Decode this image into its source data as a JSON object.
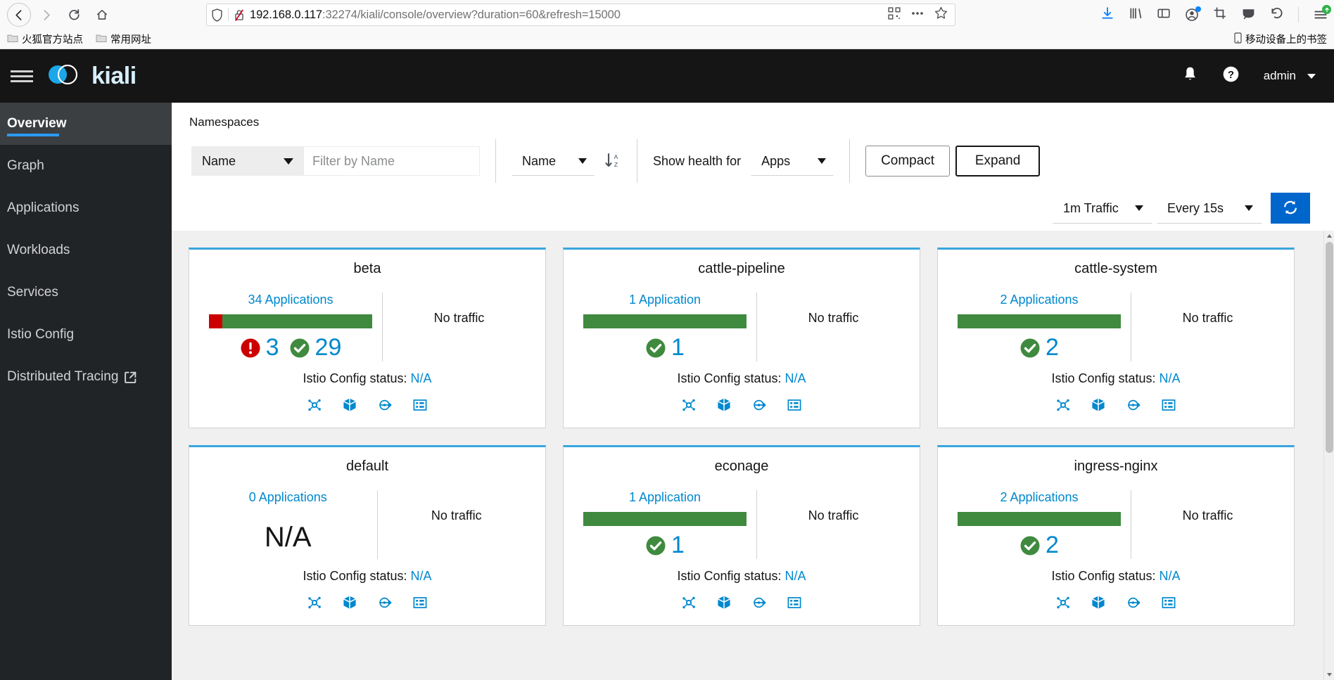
{
  "browser": {
    "url_host": "192.168.0.117",
    "url_rest": ":32274/kiali/console/overview?duration=60&refresh=15000",
    "bookmarks": [
      {
        "label": "火狐官方站点",
        "icon": "folder-icon"
      },
      {
        "label": "常用网址",
        "icon": "folder-icon"
      }
    ],
    "bookmarks_right_label": "移动设备上的书签",
    "toolbar_icons": [
      "download-icon",
      "library-icon",
      "sidebar-icon",
      "account-icon",
      "screenshot-icon",
      "pocket-icon",
      "undo-icon",
      "menu-icon"
    ],
    "nav_icons": [
      "back-icon",
      "forward-icon",
      "reload-icon",
      "home-icon"
    ]
  },
  "masthead": {
    "brand": "kiali",
    "username": "admin",
    "icons": [
      "bell-icon",
      "help-icon",
      "caret-down-icon"
    ]
  },
  "sidebar": {
    "items": [
      {
        "label": "Overview",
        "active": true,
        "external": false
      },
      {
        "label": "Graph",
        "active": false,
        "external": false
      },
      {
        "label": "Applications",
        "active": false,
        "external": false
      },
      {
        "label": "Workloads",
        "active": false,
        "external": false
      },
      {
        "label": "Services",
        "active": false,
        "external": false
      },
      {
        "label": "Istio Config",
        "active": false,
        "external": false
      },
      {
        "label": "Distributed Tracing",
        "active": false,
        "external": true
      }
    ]
  },
  "toolbar": {
    "section_title": "Namespaces",
    "filter_type": "Name",
    "filter_placeholder": "Filter by Name",
    "filter_value": "",
    "sort_by": "Name",
    "sort_direction_icon": "sort-alpha-down-icon",
    "show_health_label": "Show health for",
    "health_for": "Apps",
    "compact_label": "Compact",
    "expand_label": "Expand",
    "traffic_duration": "1m Traffic",
    "refresh_interval": "Every 15s",
    "refresh_icon": "refresh-icon"
  },
  "namespaces": [
    {
      "name": "beta",
      "apps_label": "34 Applications",
      "traffic": "No traffic",
      "istio_config_label": "Istio Config status:",
      "istio_config_value": "N/A",
      "has_bar": true,
      "error_count": "3",
      "healthy_count": "29",
      "error_pct": 8,
      "healthy_pct": 92,
      "na": false,
      "icons": [
        "graph-icon",
        "applications-icon",
        "workloads-icon",
        "istio-config-icon"
      ]
    },
    {
      "name": "cattle-pipeline",
      "apps_label": "1 Application",
      "traffic": "No traffic",
      "istio_config_label": "Istio Config status:",
      "istio_config_value": "N/A",
      "has_bar": true,
      "error_count": null,
      "healthy_count": "1",
      "error_pct": 0,
      "healthy_pct": 100,
      "na": false,
      "icons": [
        "graph-icon",
        "applications-icon",
        "workloads-icon",
        "istio-config-icon"
      ]
    },
    {
      "name": "cattle-system",
      "apps_label": "2 Applications",
      "traffic": "No traffic",
      "istio_config_label": "Istio Config status:",
      "istio_config_value": "N/A",
      "has_bar": true,
      "error_count": null,
      "healthy_count": "2",
      "error_pct": 0,
      "healthy_pct": 100,
      "na": false,
      "icons": [
        "graph-icon",
        "applications-icon",
        "workloads-icon",
        "istio-config-icon"
      ]
    },
    {
      "name": "default",
      "apps_label": "0 Applications",
      "traffic": "No traffic",
      "istio_config_label": "Istio Config status:",
      "istio_config_value": "N/A",
      "has_bar": false,
      "error_count": null,
      "healthy_count": null,
      "error_pct": 0,
      "healthy_pct": 0,
      "na": true,
      "na_text": "N/A",
      "icons": [
        "graph-icon",
        "applications-icon",
        "workloads-icon",
        "istio-config-icon"
      ]
    },
    {
      "name": "econage",
      "apps_label": "1 Application",
      "traffic": "No traffic",
      "istio_config_label": "Istio Config status:",
      "istio_config_value": "N/A",
      "has_bar": true,
      "error_count": null,
      "healthy_count": "1",
      "error_pct": 0,
      "healthy_pct": 100,
      "na": false,
      "icons": [
        "graph-icon",
        "applications-icon",
        "workloads-icon",
        "istio-config-icon"
      ]
    },
    {
      "name": "ingress-nginx",
      "apps_label": "2 Applications",
      "traffic": "No traffic",
      "istio_config_label": "Istio Config status:",
      "istio_config_value": "N/A",
      "has_bar": true,
      "error_count": null,
      "healthy_count": "2",
      "error_pct": 0,
      "healthy_pct": 100,
      "na": false,
      "icons": [
        "graph-icon",
        "applications-icon",
        "workloads-icon",
        "istio-config-icon"
      ]
    }
  ],
  "colors": {
    "accent_blue": "#0088ce",
    "card_top_border": "#39a5dc",
    "healthy_green": "#3f8a3f",
    "error_red": "#cc0000",
    "primary_button": "#0066cc",
    "masthead_bg": "#151515",
    "sidebar_bg": "#212427"
  }
}
